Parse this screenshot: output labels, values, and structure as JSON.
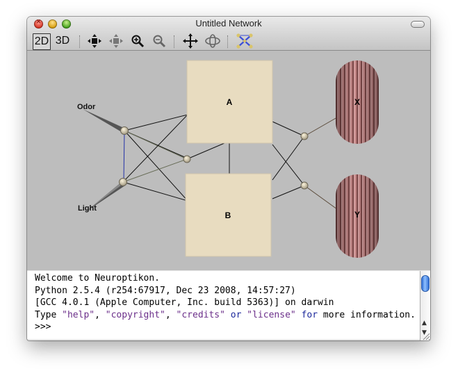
{
  "window": {
    "title": "Untitled Network"
  },
  "toolbar": {
    "view_2d": "2D",
    "view_3d": "3D",
    "icons": [
      "fit-network-icon",
      "fit-selection-icon",
      "zoom-in-icon",
      "zoom-out-icon",
      "pan-icon",
      "rotate-icon",
      "neural-network-icon"
    ]
  },
  "network": {
    "regions": [
      {
        "id": "A",
        "label": "A",
        "color": "#e8dcc0"
      },
      {
        "id": "B",
        "label": "B",
        "color": "#e8dcc0"
      }
    ],
    "muscles": [
      {
        "id": "X",
        "label": "X",
        "color": "#b07575"
      },
      {
        "id": "Y",
        "label": "Y",
        "color": "#b07575"
      }
    ],
    "stimuli": [
      {
        "id": "odor",
        "label": "Odor"
      },
      {
        "id": "light",
        "label": "Light"
      }
    ]
  },
  "console": {
    "lines": [
      "Welcome to Neuroptikon.",
      "Python 2.5.4 (r254:67917, Dec 23 2008, 14:57:27)",
      "[GCC 4.0.1 (Apple Computer, Inc. build 5363)] on darwin"
    ],
    "type_prefix": "Type ",
    "help": "\"help\"",
    "comma1": ", ",
    "copyright": "\"copyright\"",
    "comma2": ", ",
    "credits": "\"credits\"",
    "or_word": " or ",
    "license": "\"license\"",
    "space": " ",
    "for_word": "for",
    "suffix": " more information.",
    "prompt": ">>>"
  }
}
